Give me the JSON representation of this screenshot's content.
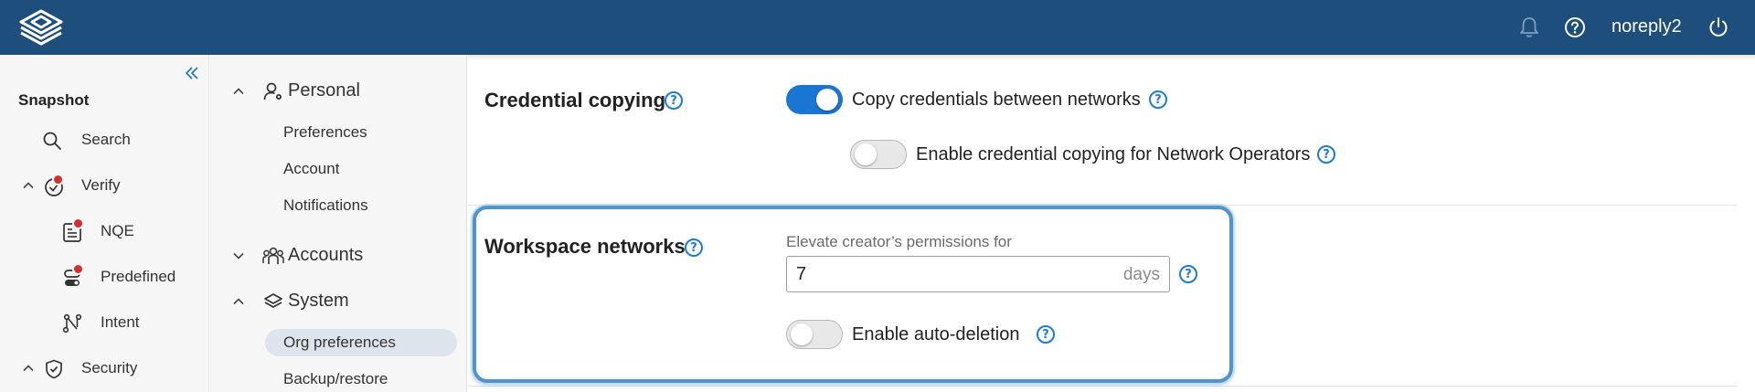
{
  "header": {
    "username": "noreply2",
    "brand_color": "#1e4e7c",
    "icons": [
      "logo-icon",
      "bell-icon",
      "help-icon",
      "power-icon"
    ]
  },
  "sidebar": {
    "section_title": "Snapshot",
    "items": [
      {
        "label": "Search",
        "icon": "search-icon"
      },
      {
        "label": "Verify",
        "icon": "verify-icon",
        "badge": true,
        "expanded": true
      },
      {
        "label": "NQE",
        "icon": "nqe-icon",
        "badge": true
      },
      {
        "label": "Predefined",
        "icon": "predefined-icon",
        "badge": true
      },
      {
        "label": "Intent",
        "icon": "intent-icon"
      },
      {
        "label": "Security",
        "icon": "shield-icon",
        "expanded": true
      }
    ]
  },
  "settings_nav": {
    "groups": [
      {
        "label": "Personal",
        "icon": "user-gear-icon",
        "expanded": true,
        "items": [
          "Preferences",
          "Account",
          "Notifications"
        ]
      },
      {
        "label": "Accounts",
        "icon": "users-icon",
        "expanded": false,
        "items": []
      },
      {
        "label": "System",
        "icon": "layers-icon",
        "expanded": true,
        "items": [
          "Org preferences",
          "Backup/restore"
        ]
      }
    ],
    "active_item": "Org preferences"
  },
  "credential_copying": {
    "title": "Credential copying",
    "copy_toggle_label": "Copy credentials between networks",
    "copy_toggle_on": true,
    "operators_toggle_label": "Enable credential copying for Network Operators",
    "operators_toggle_on": false
  },
  "workspace_networks": {
    "title": "Workspace networks",
    "elevate_label": "Elevate creator’s permissions for",
    "elevate_value": "7",
    "elevate_suffix": "days",
    "auto_delete_label": "Enable auto-deletion",
    "auto_delete_on": false
  },
  "help_glyph": "?",
  "accent_color": "#1976d2"
}
